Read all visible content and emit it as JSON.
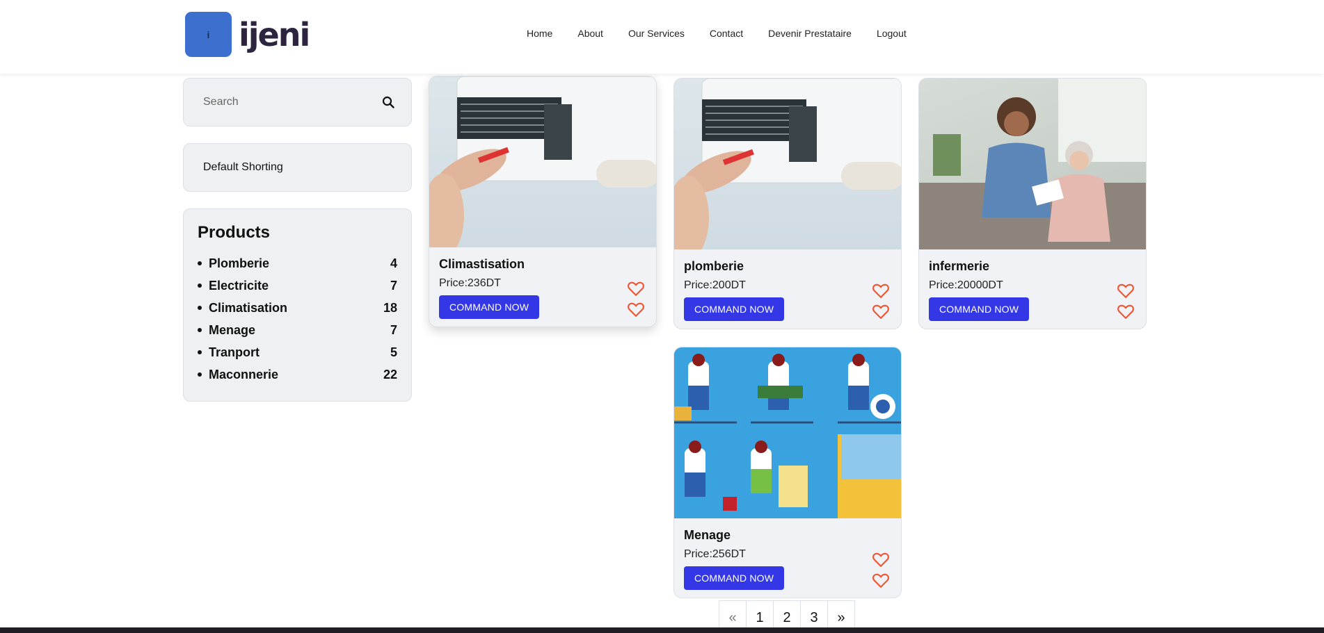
{
  "brand": {
    "name": "ijeni",
    "logo_mark": "i",
    "color": "#3d6fce"
  },
  "nav": {
    "items": [
      {
        "label": "Home"
      },
      {
        "label": "About"
      },
      {
        "label": "Our Services"
      },
      {
        "label": "Contact"
      },
      {
        "label": "Devenir Prestataire"
      },
      {
        "label": "Logout"
      }
    ]
  },
  "search": {
    "placeholder": "Search",
    "icon": "search-icon"
  },
  "sort": {
    "label": "Default Shorting"
  },
  "categories": {
    "title": "Products",
    "items": [
      {
        "label": "Plomberie",
        "count": "4"
      },
      {
        "label": "Electricite",
        "count": "7"
      },
      {
        "label": "Climatisation",
        "count": "18"
      },
      {
        "label": "Menage",
        "count": "7"
      },
      {
        "label": "Tranport",
        "count": "5"
      },
      {
        "label": "Maconnerie",
        "count": "22"
      }
    ]
  },
  "products": [
    {
      "title": "Climastisation",
      "price": "Price:236DT",
      "button": "COMMAND NOW",
      "image": "air-conditioner-repair"
    },
    {
      "title": "plomberie",
      "price": "Price:200DT",
      "button": "COMMAND NOW",
      "image": "air-conditioner-repair"
    },
    {
      "title": "infermerie",
      "price": "Price:20000DT",
      "button": "COMMAND NOW",
      "image": "nurse-with-elderly-woman"
    },
    {
      "title": "Menage",
      "price": "Price:256DT",
      "button": "COMMAND NOW",
      "image": "housekeeping-illustration"
    }
  ],
  "pagination": {
    "prev": "«",
    "pages": [
      "1",
      "2",
      "3"
    ],
    "next": "»"
  },
  "colors": {
    "button": "#3337e6",
    "heart": "#ee5533",
    "card_bg": "#f1f2f5"
  }
}
